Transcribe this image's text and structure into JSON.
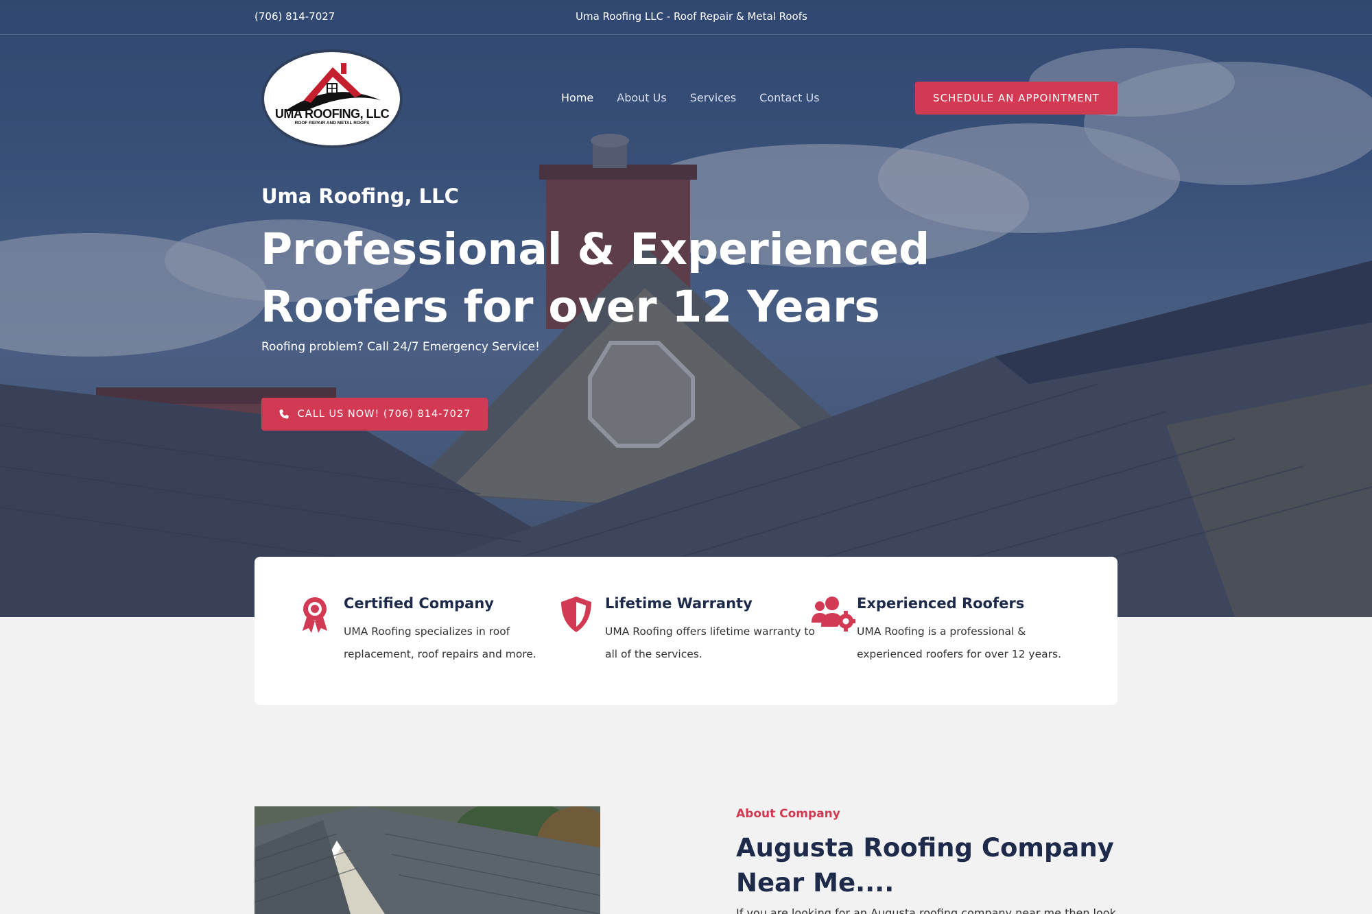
{
  "topbar": {
    "phone": "(706) 814-7027",
    "tagline": "Uma Roofing LLC - Roof Repair & Metal Roofs"
  },
  "logo": {
    "name": "UMA ROOFING, LLC",
    "subline": "ROOF REPAIR AND METAL ROOFS"
  },
  "nav": {
    "items": [
      "Home",
      "About Us",
      "Services",
      "Contact Us"
    ],
    "active": "Home"
  },
  "header": {
    "cta_label": "SCHEDULE AN APPOINTMENT"
  },
  "hero": {
    "kicker": "Uma Roofing, LLC",
    "title": "Professional & Experienced Roofers for over 12 Years",
    "subtitle": "Roofing problem? Call 24/7 Emergency Service!",
    "cta_label": "CALL US NOW! (706) 814-7027",
    "cta_icon": "phone-icon"
  },
  "features": [
    {
      "icon": "award-ribbon-icon",
      "title": "Certified Company",
      "description": "UMA Roofing specializes in roof replacement, roof repairs and more."
    },
    {
      "icon": "shield-icon",
      "title": "Lifetime Warranty",
      "description": "UMA Roofing offers lifetime warranty to all of the services."
    },
    {
      "icon": "users-gear-icon",
      "title": "Experienced Roofers",
      "description": "UMA Roofing is a professional & experienced roofers for over 12 years."
    }
  ],
  "about": {
    "kicker": "About Company",
    "title": "Augusta Roofing Company Near Me....",
    "text": "If you are looking for an Augusta roofing company near me then look"
  },
  "colors": {
    "accent": "#d23a53",
    "navy": "#1e2a4a",
    "background": "#f2f2f2"
  }
}
